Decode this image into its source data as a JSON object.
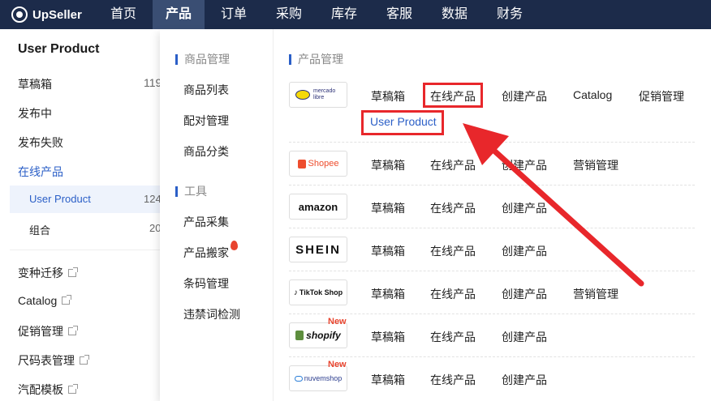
{
  "brand": "UpSeller",
  "nav": [
    "首页",
    "产品",
    "订单",
    "采购",
    "库存",
    "客服",
    "数据",
    "财务"
  ],
  "sidebar": {
    "title": "User Product",
    "items": [
      {
        "label": "草稿箱",
        "count": "119"
      },
      {
        "label": "发布中"
      },
      {
        "label": "发布失败"
      },
      {
        "label": "在线产品"
      }
    ],
    "sub_items": [
      {
        "label": "User Product",
        "count": "124"
      },
      {
        "label": "组合",
        "count": "20"
      }
    ],
    "ext_items": [
      "变种迁移",
      "Catalog",
      "促销管理",
      "尺码表管理",
      "汽配模板"
    ]
  },
  "menu": {
    "product_mgmt_head": "商品管理",
    "product_mgmt": [
      "商品列表",
      "配对管理",
      "商品分类"
    ],
    "tools_head": "工具",
    "tools": [
      "产品采集",
      "产品搬家",
      "条码管理",
      "违禁词检测"
    ],
    "platform_head": "产品管理"
  },
  "platforms": [
    {
      "name": "mercado libre",
      "links": [
        "草稿箱",
        "在线产品",
        "创建产品",
        "Catalog",
        "促销管理"
      ],
      "sub_link": "User Product"
    },
    {
      "name": "Shopee",
      "links": [
        "草稿箱",
        "在线产品",
        "创建产品",
        "营销管理"
      ]
    },
    {
      "name": "amazon",
      "links": [
        "草稿箱",
        "在线产品",
        "创建产品"
      ]
    },
    {
      "name": "SHEIN",
      "links": [
        "草稿箱",
        "在线产品",
        "创建产品"
      ]
    },
    {
      "name": "TikTok Shop",
      "links": [
        "草稿箱",
        "在线产品",
        "创建产品",
        "营销管理"
      ]
    },
    {
      "name": "shopify",
      "badge": "New",
      "links": [
        "草稿箱",
        "在线产品",
        "创建产品"
      ]
    },
    {
      "name": "nuvemshop",
      "badge": "New",
      "links": [
        "草稿箱",
        "在线产品",
        "创建产品"
      ]
    }
  ],
  "colors": {
    "nav_bg": "#1c2b4a",
    "accent": "#2b5fc7",
    "highlight": "#e8272b"
  }
}
